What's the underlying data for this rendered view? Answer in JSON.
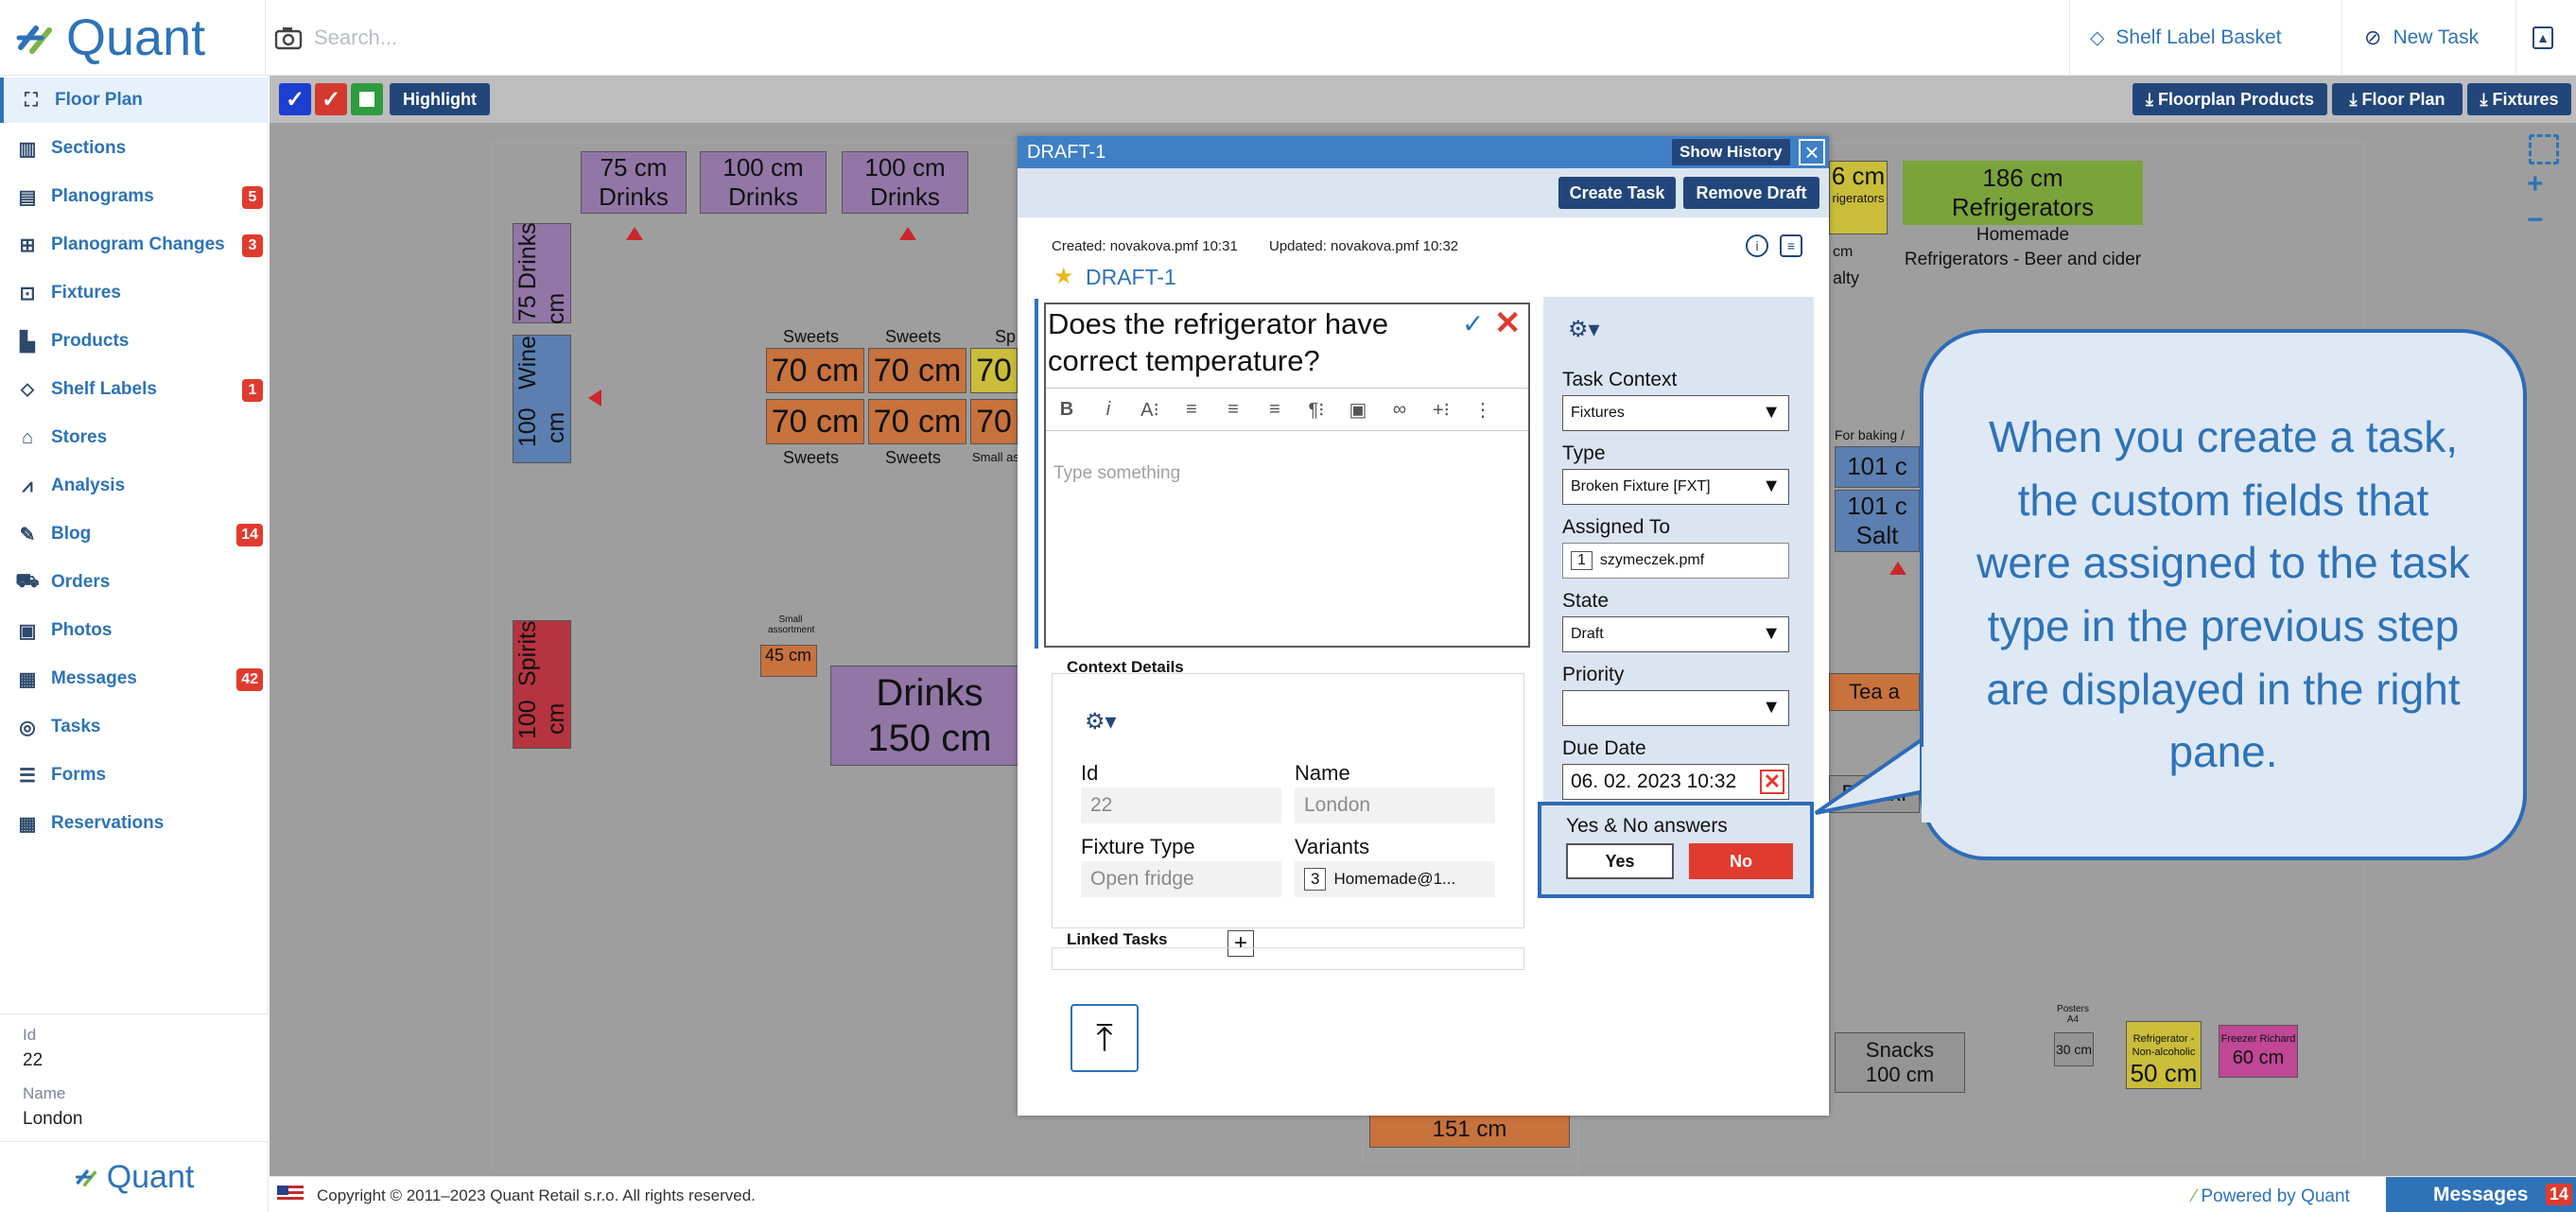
{
  "app": {
    "logo_text": "Quant"
  },
  "search": {
    "placeholder": "Search..."
  },
  "header": {
    "shelf_label_basket": "Shelf Label Basket",
    "new_task": "New Task"
  },
  "sidebar": {
    "items": [
      {
        "label": "Floor Plan",
        "icon": "floor-plan-icon",
        "badge": ""
      },
      {
        "label": "Sections",
        "icon": "sections-icon",
        "badge": ""
      },
      {
        "label": "Planograms",
        "icon": "planograms-icon",
        "badge": "5"
      },
      {
        "label": "Planogram Changes",
        "icon": "planogram-changes-icon",
        "badge": "3"
      },
      {
        "label": "Fixtures",
        "icon": "fixtures-icon",
        "badge": ""
      },
      {
        "label": "Products",
        "icon": "products-icon",
        "badge": ""
      },
      {
        "label": "Shelf Labels",
        "icon": "tag-icon",
        "badge": "1"
      },
      {
        "label": "Stores",
        "icon": "store-icon",
        "badge": ""
      },
      {
        "label": "Analysis",
        "icon": "analysis-icon",
        "badge": ""
      },
      {
        "label": "Blog",
        "icon": "blog-icon",
        "badge": "14"
      },
      {
        "label": "Orders",
        "icon": "orders-icon",
        "badge": ""
      },
      {
        "label": "Photos",
        "icon": "photos-icon",
        "badge": ""
      },
      {
        "label": "Messages",
        "icon": "messages-icon",
        "badge": "42"
      },
      {
        "label": "Tasks",
        "icon": "tasks-icon",
        "badge": ""
      },
      {
        "label": "Forms",
        "icon": "forms-icon",
        "badge": ""
      },
      {
        "label": "Reservations",
        "icon": "calendar-icon",
        "badge": ""
      }
    ],
    "info": {
      "id_label": "Id",
      "id_value": "22",
      "name_label": "Name",
      "name_value": "London"
    },
    "bottom_logo": "Quant"
  },
  "toolbar": {
    "highlight": "Highlight",
    "floorplan_products": "Floorplan Products",
    "floor_plan": "Floor Plan",
    "fixtures": "Fixtures",
    "zoom_in": "+",
    "zoom_out": "−"
  },
  "floorplan": {
    "blocks": [
      {
        "t1": "75 cm",
        "t2": "Drinks"
      },
      {
        "t1": "100 cm",
        "t2": "Drinks"
      },
      {
        "t1": "100 cm",
        "t2": "Drinks"
      },
      {
        "t1": "75 cm",
        "t2": "Drinks"
      },
      {
        "t1": "100 cm",
        "t2": "Wine"
      },
      {
        "t1": "100 cm",
        "t2": "Spirits"
      },
      {
        "t1": "Drinks",
        "t2": "150 cm"
      },
      {
        "t1": "186 cm",
        "t2": "Refrigerators"
      },
      {
        "t1": "Snacks",
        "t2": "100 cm"
      },
      {
        "t1": "151 cm",
        "t2": ""
      },
      {
        "t1": "50 cm",
        "t2": ""
      },
      {
        "t1": "60 cm",
        "t2": ""
      },
      {
        "t1": "6 cm",
        "t2": ""
      },
      {
        "t1": "101 c",
        "t2": ""
      },
      {
        "t1": "101 c",
        "t2": "Salt"
      },
      {
        "t1": "Breakf",
        "t2": ""
      },
      {
        "t1": "Tea a",
        "t2": ""
      }
    ],
    "labels": {
      "sweets": "Sweets",
      "sweets_short": "Sp",
      "small_as": "Small as",
      "seventy": "70 cm",
      "seventy_short": "70",
      "small_assortment": "Small assortment",
      "forty_five": "45 cm",
      "homemade": "Homemade",
      "refrigerators_beer": "Refrigerators - Beer and cider",
      "refrigerators_short": "rigerators",
      "cm": "cm",
      "salty": "alty",
      "for_baking": "For baking /",
      "posters": "Posters A4",
      "thirty": "30 cm",
      "ref_nonalc": "Refrigerator - Non-alcoholic",
      "freezer": "Freezer Richard"
    }
  },
  "modal": {
    "title": "DRAFT-1",
    "show_history": "Show History",
    "create_task": "Create Task",
    "remove_draft": "Remove Draft",
    "created": "Created:  novakova.pmf   10:31",
    "updated": "Updated:  novakova.pmf   10:32",
    "draft_title": "DRAFT-1",
    "question": "Does the refrigerator have correct temperature?",
    "placeholder": "Type something",
    "context_details": "Context Details",
    "id_label": "Id",
    "id_value": "22",
    "name_label": "Name",
    "name_value": "London",
    "fixture_type_label": "Fixture Type",
    "fixture_type_value": "Open fridge",
    "variants_label": "Variants",
    "variants_count": "3",
    "variants_value": "Homemade@1...",
    "linked_tasks": "Linked Tasks",
    "right": {
      "task_context_label": "Task Context",
      "task_context_value": "Fixtures",
      "type_label": "Type",
      "type_value": "Broken Fixture [FXT]",
      "assigned_label": "Assigned To",
      "assigned_count": "1",
      "assigned_value": "szymeczek.pmf",
      "state_label": "State",
      "state_value": "Draft",
      "priority_label": "Priority",
      "priority_value": "",
      "due_label": "Due Date",
      "due_value": "06. 02. 2023 10:32",
      "yesno_label": "Yes & No answers",
      "yes": "Yes",
      "no": "No"
    }
  },
  "callout": {
    "text": "When you create a task, the custom fields that were assigned to the task type in the previous step are displayed in the right pane."
  },
  "footer": {
    "copyright": "Copyright © 2011–2023 Quant Retail s.r.o. All rights reserved.",
    "powered": "Powered by Quant",
    "messages": "Messages",
    "messages_count": "14"
  },
  "colors": {
    "brand": "#2e73b8",
    "dark": "#22467a",
    "badge": "#e03b2f"
  }
}
